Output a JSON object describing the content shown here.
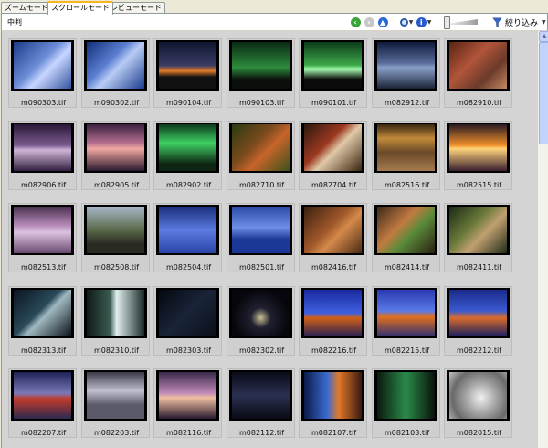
{
  "tabs": [
    {
      "label": "ズームモード"
    },
    {
      "label": "スクロールモード"
    },
    {
      "label": "プレビューモード"
    }
  ],
  "toolbar": {
    "title": "中判",
    "filter_label": "絞り込み",
    "icons": [
      "back-icon",
      "forward-icon",
      "up-icon",
      "zoom-icon",
      "info-icon",
      "size-slider",
      "filter-icon"
    ]
  },
  "thumbnails": [
    {
      "name": "m090303.tif",
      "bg": "linear-gradient(135deg,#1c3c8a,#6d8dd8 45%,#c6d6ff 60%,#36539f)"
    },
    {
      "name": "m090302.tif",
      "bg": "linear-gradient(135deg,#12307c,#5b7fd1 40%,#b9ccf5 55%,#1a3c8e)"
    },
    {
      "name": "m090104.tif",
      "bg": "linear-gradient(180deg,#0e1630,#3a3b63 50%,#e07b2a 62%,#111 75%)"
    },
    {
      "name": "m090103.tif",
      "bg": "linear-gradient(180deg,#0a2a14,#2e8c3c 55%,#0b0f0b 80%)"
    },
    {
      "name": "m090101.tif",
      "bg": "linear-gradient(180deg,#0b3a1a,#3faa4a 50%,#a8ffb0 58%,#0a0a0a 80%)"
    },
    {
      "name": "m082912.tif",
      "bg": "linear-gradient(180deg,#0d1b3b,#5a6d9a 45%,#8aa0c9 55%,#1b2438)"
    },
    {
      "name": "m082910.tif",
      "bg": "linear-gradient(135deg,#5a2412,#b1553a 40%,#6b3a2a 70%,#c58a62)"
    },
    {
      "name": "m082906.tif",
      "bg": "linear-gradient(180deg,#2b1838,#7b5b8e 45%,#cfb5d8 55%,#322040)"
    },
    {
      "name": "m082905.tif",
      "bg": "linear-gradient(180deg,#3d2040,#b5708f 40%,#f0a7a0 52%,#2a1a2e)"
    },
    {
      "name": "m082902.tif",
      "bg": "linear-gradient(180deg,#0b3b1c,#3fcf63 40%,#0d2512 85%)"
    },
    {
      "name": "m082710.tif",
      "bg": "linear-gradient(135deg,#2b3a12,#7a4a1c 40%,#c7642a 60%,#3b5219)"
    },
    {
      "name": "m082704.tif",
      "bg": "linear-gradient(135deg,#2a1a0e,#9c3820 40%,#e0c9a8 55%,#3a2410)"
    },
    {
      "name": "m082516.tif",
      "bg": "linear-gradient(180deg,#3a2710,#c08a3a 30%,#6a4a28 60%,#a47b4e)"
    },
    {
      "name": "m082515.tif",
      "bg": "linear-gradient(180deg,#2a1a22,#f0902a 45%,#ffd37a 52%,#3a2030)"
    },
    {
      "name": "m082513.tif",
      "bg": "linear-gradient(180deg,#4a3050,#b58ab8 40%,#dcc2e0 55%,#6a4a70)"
    },
    {
      "name": "m082508.tif",
      "bg": "linear-gradient(180deg,#a6b6c8,#5a6a4a 50%,#2a2a22 80%)"
    },
    {
      "name": "m082504.tif",
      "bg": "linear-gradient(180deg,#1a2f7a,#5b7be0 50%,#2a45a8)"
    },
    {
      "name": "m082501.tif",
      "bg": "linear-gradient(180deg,#2b4ba8,#6c8ee6 45%,#1c3896 70%)"
    },
    {
      "name": "m082416.tif",
      "bg": "linear-gradient(135deg,#3a2010,#a0582a 45%,#d48a4a 60%,#4a2a14)"
    },
    {
      "name": "m082414.tif",
      "bg": "linear-gradient(135deg,#3a2a1a,#c27a40 40%,#5a8a3a 60%,#2a2010)"
    },
    {
      "name": "m082411.tif",
      "bg": "linear-gradient(135deg,#1a2a14,#6b7a3a 40%,#c0a070 60%,#1f2a18)"
    },
    {
      "name": "m082313.tif",
      "bg": "linear-gradient(135deg,#0a1420,#2a4a5a 45%,#a0b8c0 55%,#0a1018)"
    },
    {
      "name": "m082310.tif",
      "bg": "linear-gradient(90deg,#0e1a1a,#3a5a50 40%,#e0f0f0 52%,#1a2a28)"
    },
    {
      "name": "m082303.tif",
      "bg": "linear-gradient(135deg,#05080f,#1a2438 50%,#0a0f18)"
    },
    {
      "name": "m082302.tif",
      "bg": "radial-gradient(circle at 50% 60%,#c8c090,#202030 25%,#06060c 70%)"
    },
    {
      "name": "m082216.tif",
      "bg": "linear-gradient(180deg,#1a2aa0,#4060e0 50%,#d0601a 60%,#2a2050)"
    },
    {
      "name": "m082215.tif",
      "bg": "linear-gradient(180deg,#2a3ab0,#5a7ae8 45%,#e07020 58%,#303070)"
    },
    {
      "name": "m082212.tif",
      "bg": "linear-gradient(180deg,#1a2a8a,#3a5ad0 45%,#d86a2a 60%,#1a2060)"
    },
    {
      "name": "m082207.tif",
      "bg": "linear-gradient(180deg,#202058,#7a7ab8 45%,#c03a2a 58%,#2a2a50)"
    },
    {
      "name": "m082203.tif",
      "bg": "linear-gradient(180deg,#3a3a4a,#c0c0d0 40%,#5a5a6a 70%)"
    },
    {
      "name": "m082116.tif",
      "bg": "linear-gradient(180deg,#3a2a4a,#c08ab8 45%,#f0c0a0 55%,#2a1a30)"
    },
    {
      "name": "m082112.tif",
      "bg": "linear-gradient(180deg,#0a0a18,#2a3050 50%,#0a0a14)"
    },
    {
      "name": "m082107.tif",
      "bg": "linear-gradient(90deg,#0a1a4a,#3a6ad0 40%,#e07a2a 60%,#3a1a10)"
    },
    {
      "name": "m082103.tif",
      "bg": "linear-gradient(90deg,#0a1a0e,#2a8a4a 50%,#0a120a)"
    },
    {
      "name": "m082015.tif",
      "bg": "radial-gradient(circle at 55% 55%,#f0f0f0,#a0a0a0 40%,#6a6a6a 70%,#c0c0c0)"
    }
  ]
}
